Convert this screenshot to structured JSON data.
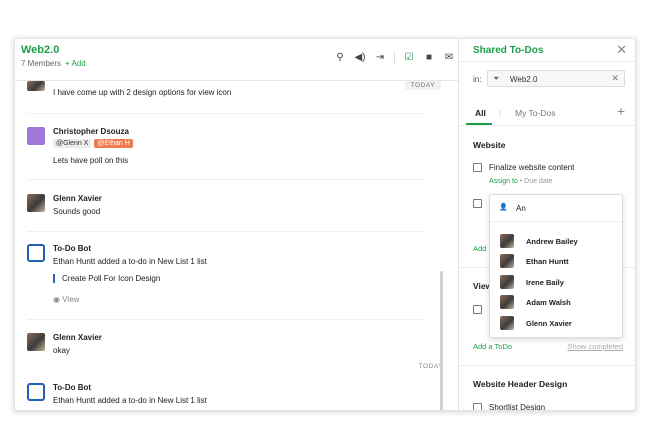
{
  "chat": {
    "title": "Web2.0",
    "members": "7 Members",
    "add": "+ Add",
    "icons": [
      "paperclip-icon",
      "speaker-icon",
      "exit-icon",
      "checkbox-icon",
      "video-icon",
      "mail-icon"
    ]
  },
  "messages": {
    "m1_text": "I have come up with 2 design options for view icon",
    "m1_day": "TODAY",
    "m2_name": "Christopher Dsouza",
    "m2_tag1": "@Glenn X",
    "m2_tag2": "@Ethan H",
    "m2_text": "Lets have poll on this",
    "m3_name": "Glenn Xavier",
    "m3_text": "Sounds good",
    "m4_name": "To-Do Bot",
    "m4_text": "Ethan Huntt added a to-do in New List 1 list",
    "m4_quote": "Create Poll For Icon Design",
    "m4_view": "View",
    "m5_name": "Glenn Xavier",
    "m5_text": "okay",
    "m5_day": "TODAY",
    "m6_name": "To-Do Bot",
    "m6_text": "Ethan Huntt added a to-do in New List 1 list"
  },
  "panel": {
    "title": "Shared To-Dos",
    "close": "✕",
    "in_label": "in:",
    "in_value": "Web2.0",
    "in_clear": "✕",
    "tab_all": "All",
    "tab_sep": "|",
    "tab_my": "My To-Dos",
    "tab_add": "+",
    "section1": "Website",
    "todo1": "Finalize website content",
    "assign_to": "Assign to",
    "due_date": "Due date",
    "add_partial": "Add",
    "section2_partial": "View",
    "add_todo": "Add a ToDo",
    "show_completed": "Show completed",
    "section3": "Website Header Design",
    "todo3": "Shortlist Design"
  },
  "dropdown": {
    "query": "An",
    "people": [
      "Andrew Bailey",
      "Ethan Huntt",
      "Irene Baily",
      "Adam Walsh",
      "Glenn Xavier"
    ]
  },
  "colors": {
    "brand_green": "#1e9e4a",
    "bot_blue": "#1f5fb8",
    "mention_orange": "#ee7b50"
  }
}
